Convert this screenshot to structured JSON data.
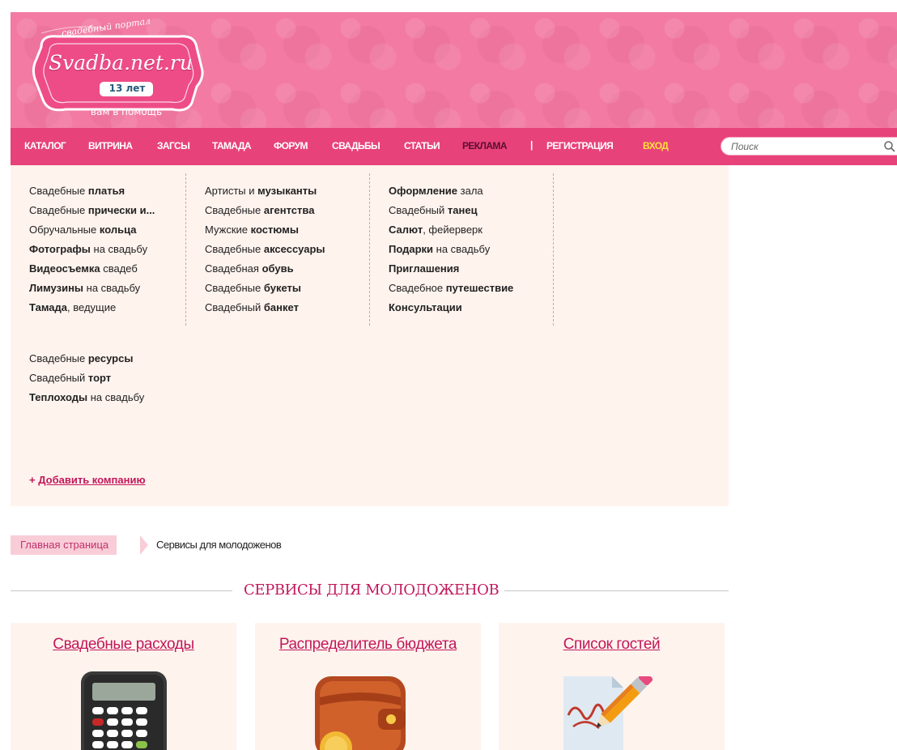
{
  "logo": {
    "top_text": "свадебный портал",
    "main_text": "Svadba.net.ru",
    "years_badge": "13 лет",
    "bottom_text": "вам в помощь"
  },
  "nav": {
    "items": [
      "КАТАЛОГ",
      "ВИТРИНА",
      "ЗАГСЫ",
      "ТАМАДА",
      "ФОРУМ",
      "СВАДЬБЫ",
      "СТАТЬИ",
      "РЕКЛАМА",
      "РЕГИСТРАЦИЯ",
      "ВХОД"
    ],
    "separator": "|",
    "search_placeholder": "Поиск"
  },
  "catalog": {
    "col1": [
      [
        "Свадебные ",
        "платья"
      ],
      [
        "Свадебные ",
        "прически и..."
      ],
      [
        "Обручальные ",
        "кольца"
      ],
      [
        "Фотографы",
        " на свадьбу"
      ],
      [
        "Видеосъемка",
        " свадеб"
      ],
      [
        "Лимузины",
        " на свадьбу"
      ],
      [
        "Тамада",
        ", ведущие"
      ]
    ],
    "col2": [
      [
        "Артисты и ",
        "музыканты"
      ],
      [
        "Свадебные ",
        "агентства"
      ],
      [
        "Мужские ",
        "костюмы"
      ],
      [
        "Свадебные ",
        "аксессуары"
      ],
      [
        "Свадебная ",
        "обувь"
      ],
      [
        "Свадебные ",
        "букеты"
      ],
      [
        "Свадебный ",
        "банкет"
      ]
    ],
    "col3": [
      [
        "Оформление",
        " зала"
      ],
      [
        "Свадебный ",
        "танец"
      ],
      [
        "Салют",
        ", фейерверк"
      ],
      [
        "Подарки",
        " на свадьбу"
      ],
      [
        "Приглашения",
        ""
      ],
      [
        "Свадебное ",
        "путешествие"
      ],
      [
        "Консультации",
        ""
      ]
    ],
    "col4": [
      [
        "Свадебные ",
        "ресурсы"
      ],
      [
        "Свадебный ",
        "торт"
      ],
      [
        "Теплоходы",
        " на свадьбу"
      ]
    ],
    "add_company_prefix": "+ ",
    "add_company": "Добавить компанию"
  },
  "breadcrumb": {
    "home": "Главная страница",
    "current": "Сервисы для молодоженов"
  },
  "section_title": "СЕРВИСЫ ДЛЯ МОЛОДОЖЕНОВ",
  "cards": [
    {
      "title": "Свадебные расходы",
      "icon": "calculator-icon"
    },
    {
      "title": "Распределитель бюджета",
      "icon": "wallet-icon"
    },
    {
      "title": "Список гостей",
      "icon": "list-pencil-icon"
    }
  ],
  "colors": {
    "brand_pink": "#e8427b",
    "header_pink": "#f27aa3",
    "panel_bg": "#fff3ee",
    "link_accent": "#c2185b",
    "login_yellow": "#ffe23a"
  }
}
